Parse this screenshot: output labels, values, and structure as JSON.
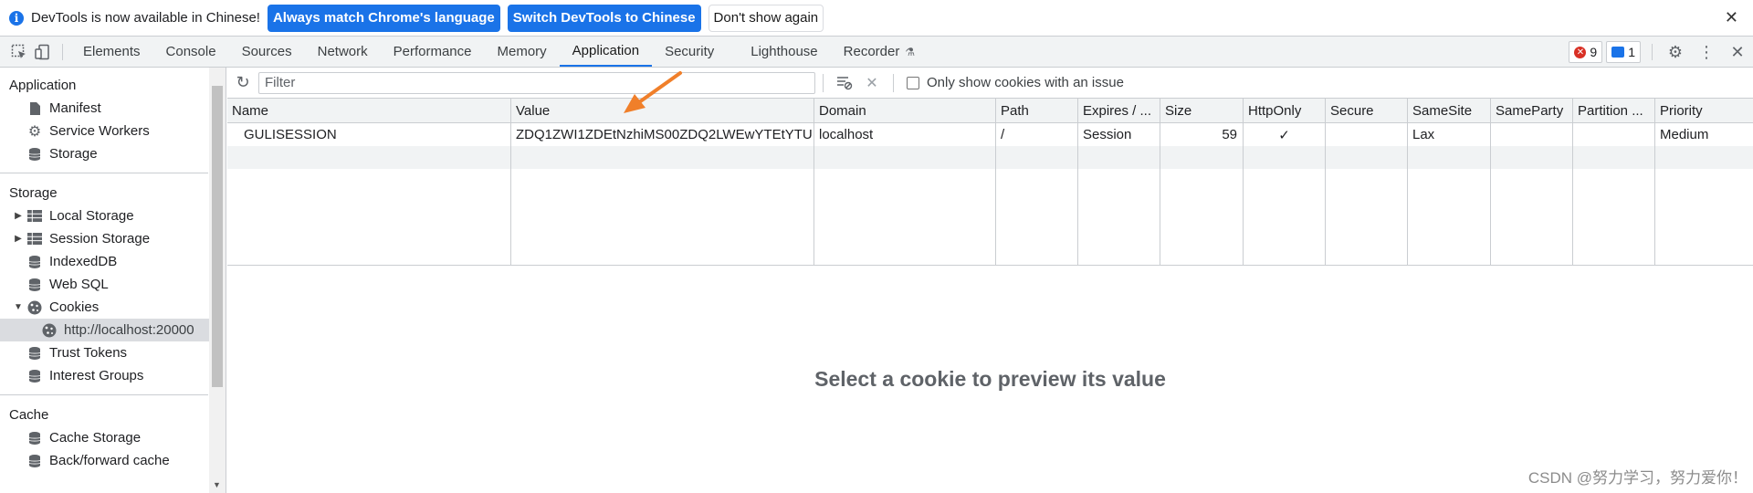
{
  "infobar": {
    "message": "DevTools is now available in Chinese!",
    "buttons": [
      "Always match Chrome's language",
      "Switch DevTools to Chinese",
      "Don't show again"
    ]
  },
  "tabs": [
    "Elements",
    "Console",
    "Sources",
    "Network",
    "Performance",
    "Memory",
    "Application",
    "Security",
    "Lighthouse",
    "Recorder"
  ],
  "active_tab": "Application",
  "counts": {
    "errors": "9",
    "messages": "1"
  },
  "sidebar": {
    "application_header": "Application",
    "application_items": [
      "Manifest",
      "Service Workers",
      "Storage"
    ],
    "storage_header": "Storage",
    "storage_items": [
      "Local Storage",
      "Session Storage",
      "IndexedDB",
      "Web SQL",
      "Cookies"
    ],
    "cookie_origin": "http://localhost:20000",
    "more_items": [
      "Trust Tokens",
      "Interest Groups"
    ],
    "cache_header": "Cache",
    "cache_items": [
      "Cache Storage",
      "Back/forward cache"
    ]
  },
  "toolbar": {
    "filter_placeholder": "Filter",
    "only_issues_label": "Only show cookies with an issue"
  },
  "table": {
    "columns": [
      "Name",
      "Value",
      "Domain",
      "Path",
      "Expires / ...",
      "Size",
      "HttpOnly",
      "Secure",
      "SameSite",
      "SameParty",
      "Partition ...",
      "Priority"
    ],
    "rows": [
      [
        "GULISESSION",
        "ZDQ1ZWI1ZDEtNzhiMS00ZDQ2LWEwYTEtYTU...",
        "localhost",
        "/",
        "Session",
        "59",
        "✓",
        "",
        "Lax",
        "",
        "",
        "Medium"
      ]
    ]
  },
  "preview_message": "Select a cookie to preview its value",
  "watermark": "CSDN @努力学习，努力爱你！",
  "colors": {
    "accent": "#1a73e8",
    "arrow": "#f07f2a"
  }
}
